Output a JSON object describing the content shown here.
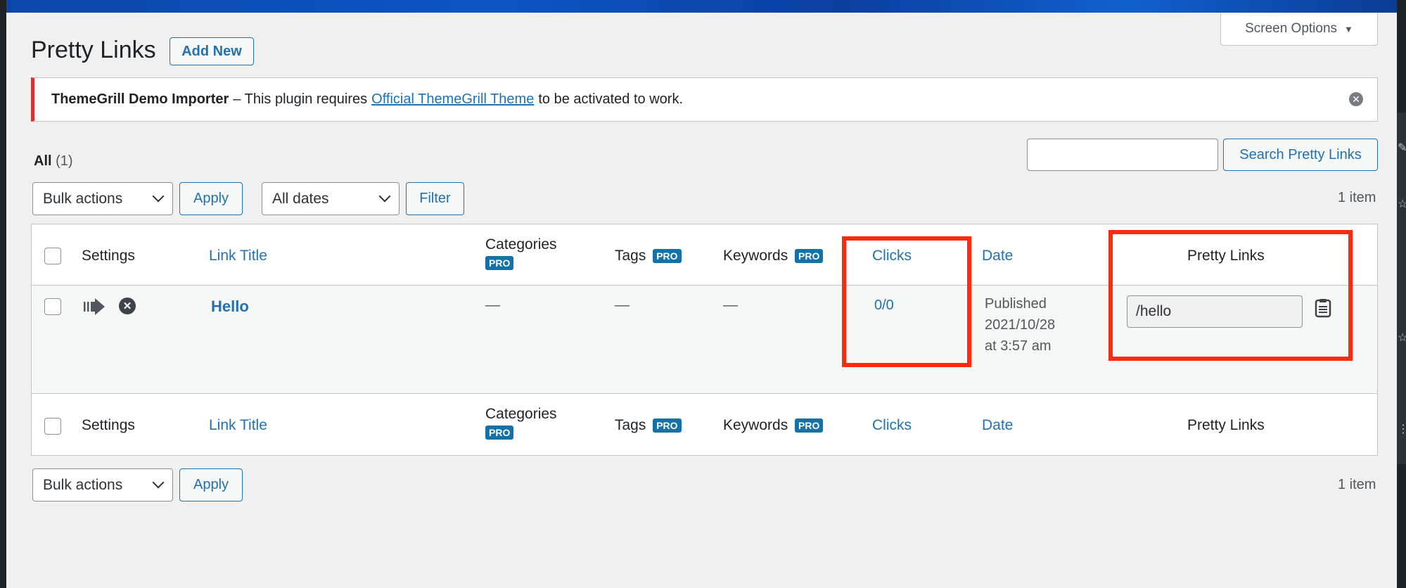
{
  "header": {
    "page_title": "Pretty Links",
    "add_new_label": "Add New",
    "screen_options_label": "Screen Options"
  },
  "notice": {
    "plugin_name": "ThemeGrill Demo Importer",
    "text_before": "– This plugin requires",
    "link_text": "Official ThemeGrill Theme",
    "text_after": "to be activated to work."
  },
  "views": {
    "all_label": "All",
    "all_count": "(1)"
  },
  "search": {
    "button_label": "Search Pretty Links",
    "placeholder": ""
  },
  "toolbar_top": {
    "bulk_actions": "Bulk actions",
    "apply_label": "Apply",
    "dates": "All dates",
    "filter_label": "Filter",
    "items": "1 item"
  },
  "toolbar_bottom": {
    "bulk_actions": "Bulk actions",
    "apply_label": "Apply",
    "items": "1 item"
  },
  "table": {
    "columns": {
      "settings": "Settings",
      "link_title": "Link Title",
      "categories": "Categories",
      "tags": "Tags",
      "keywords": "Keywords",
      "clicks": "Clicks",
      "date": "Date",
      "pretty_links": "Pretty Links"
    },
    "pro_badge": "PRO",
    "rows": [
      {
        "title": "Hello",
        "categories": "—",
        "tags": "—",
        "keywords": "—",
        "clicks": "0/0",
        "date_status": "Published",
        "date_day": "2021/10/28",
        "date_time": "at 3:57 am",
        "pretty_link": "/hello"
      }
    ]
  },
  "colors": {
    "accent": "#2271b1",
    "highlight": "#ff2a10",
    "notice_error": "#d63638",
    "pro_badge": "#1372a8"
  }
}
